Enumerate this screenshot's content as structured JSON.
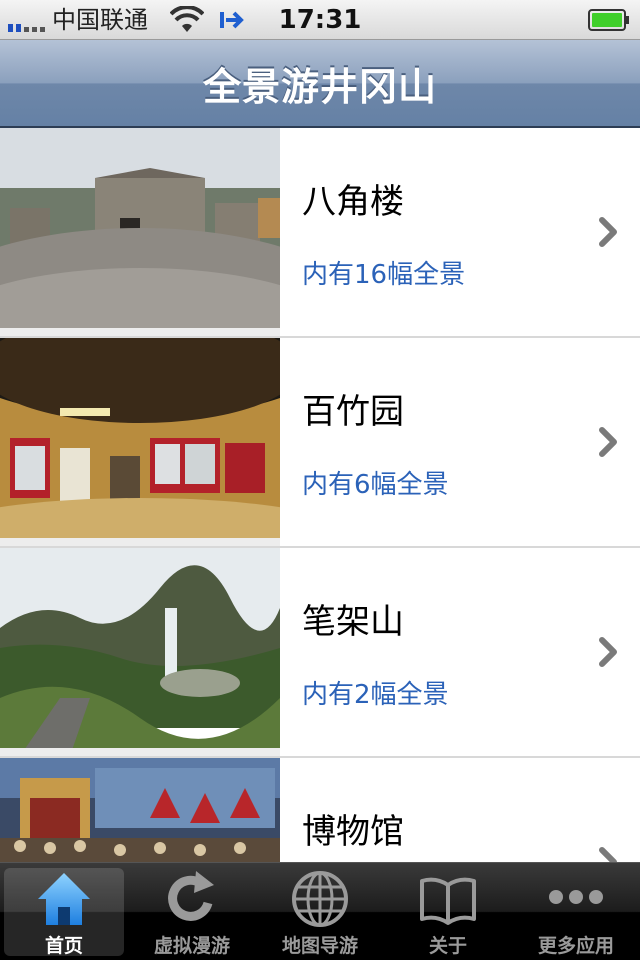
{
  "status_bar": {
    "carrier": "中国联通",
    "time": "17:31",
    "icons": [
      "signal-icon",
      "wifi-icon",
      "sync-icon",
      "battery-icon"
    ]
  },
  "nav": {
    "title": "全景游井冈山"
  },
  "list": {
    "items": [
      {
        "title": "八角楼",
        "subtitle": "内有16幅全景",
        "thumb": "stone-courtyard-panorama"
      },
      {
        "title": "百竹园",
        "subtitle": "内有6幅全景",
        "thumb": "exhibition-room-panorama"
      },
      {
        "title": "笔架山",
        "subtitle": "内有2幅全景",
        "thumb": "waterfall-mountain-panorama"
      },
      {
        "title": "博物馆",
        "subtitle": "",
        "thumb": "museum-mural-panorama"
      }
    ]
  },
  "tab_bar": {
    "tabs": [
      {
        "label": "首页",
        "icon": "home-icon",
        "selected": true
      },
      {
        "label": "虚拟漫游",
        "icon": "refresh-icon",
        "selected": false
      },
      {
        "label": "地图导游",
        "icon": "globe-icon",
        "selected": false
      },
      {
        "label": "关于",
        "icon": "book-icon",
        "selected": false
      },
      {
        "label": "更多应用",
        "icon": "more-icon",
        "selected": false
      }
    ]
  },
  "colors": {
    "nav_bar": "#7b93b4",
    "subtitle_blue": "#2b62b8",
    "tab_bar": "#000000"
  }
}
